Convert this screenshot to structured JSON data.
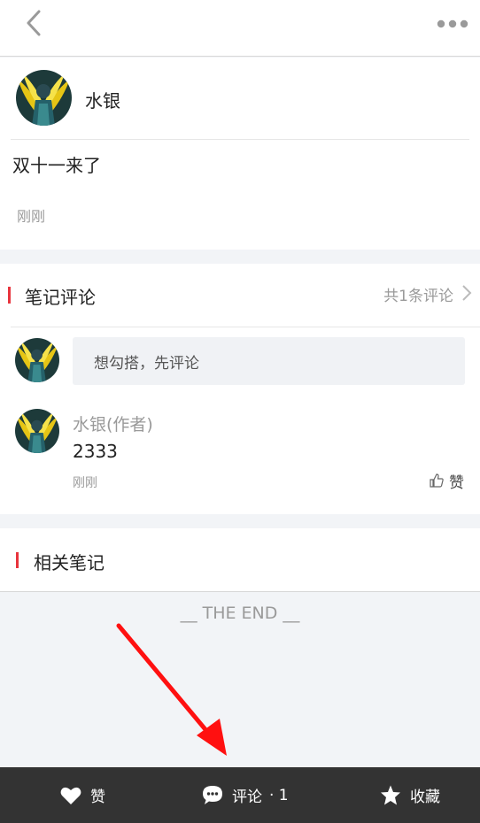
{
  "header": {
    "back_icon": "chevron-left-icon",
    "more_icon": "more-dots-icon"
  },
  "note": {
    "author": "水银",
    "text": "双十一来了",
    "time": "刚刚"
  },
  "comments": {
    "section_title": "笔记评论",
    "count_label": "共1条评论",
    "input_placeholder": "想勾搭，先评论",
    "items": [
      {
        "author": "水银(作者)",
        "text": "2333",
        "time": "刚刚",
        "like_label": "赞"
      }
    ]
  },
  "related": {
    "section_title": "相关笔记",
    "end_label": "__ THE END __"
  },
  "bottom_bar": {
    "like_label": "赞",
    "comment_label": "评论",
    "comment_count": "· 1",
    "favorite_label": "收藏"
  },
  "colors": {
    "accent": "#e8343d",
    "bottom_bar": "#333333",
    "annotation_arrow": "#ff1010"
  }
}
